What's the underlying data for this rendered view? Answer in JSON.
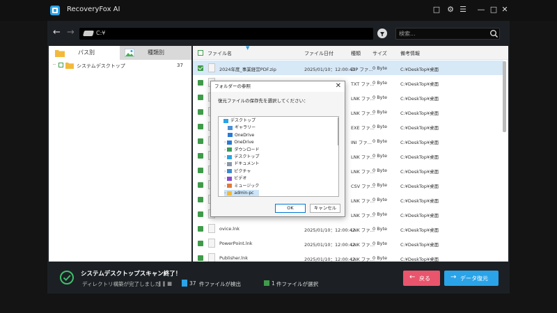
{
  "app": {
    "title": "RecoveryFox AI"
  },
  "toolbar": {
    "path": "C:¥",
    "search_placeholder": "検索..."
  },
  "left_panel": {
    "tab_folder": "パス別",
    "tab_type": "種類別",
    "tree": [
      {
        "label": "システムデスクトップ",
        "count": "37"
      }
    ]
  },
  "table": {
    "headers": {
      "name": "ファイル名",
      "date": "ファイル日付",
      "type": "種類",
      "size": "サイズ",
      "note": "備考情報"
    },
    "rows": [
      {
        "name": "2024年度_事業経営PDF.zip",
        "date": "2025/01/10：12:00:42",
        "type": "ZIP ファ...",
        "size": "0 Byte",
        "note": "C:¥DeskTop¥桌面",
        "selected": true
      },
      {
        "name": "",
        "date": "",
        "type": "TXT ファ...",
        "size": "0 Byte",
        "note": "C:¥DeskTop¥桌面"
      },
      {
        "name": "",
        "date": "",
        "type": "LNK ファ...",
        "size": "0 Byte",
        "note": "C:¥DeskTop¥桌面"
      },
      {
        "name": "",
        "date": "",
        "type": "LNK ファ...",
        "size": "0 Byte",
        "note": "C:¥DeskTop¥桌面"
      },
      {
        "name": "",
        "date": "",
        "type": "EXE ファ...",
        "size": "0 Byte",
        "note": "C:¥DeskTop¥桌面"
      },
      {
        "name": "",
        "date": "",
        "type": "INI ファ...",
        "size": "0 Byte",
        "note": "C:¥DeskTop¥桌面"
      },
      {
        "name": "",
        "date": "",
        "type": "LNK ファ...",
        "size": "0 Byte",
        "note": "C:¥DeskTop¥桌面"
      },
      {
        "name": "",
        "date": "",
        "type": "LNK ファ...",
        "size": "0 Byte",
        "note": "C:¥DeskTop¥桌面"
      },
      {
        "name": "",
        "date": "",
        "type": "CSV ファ...",
        "size": "0 Byte",
        "note": "C:¥DeskTop¥桌面"
      },
      {
        "name": "",
        "date": "",
        "type": "LNK ファ...",
        "size": "0 Byte",
        "note": "C:¥DeskTop¥桌面"
      },
      {
        "name": "",
        "date": "",
        "type": "LNK ファ...",
        "size": "0 Byte",
        "note": "C:¥DeskTop¥桌面"
      },
      {
        "name": "ovice.lnk",
        "date": "2025/01/10：12:00:42",
        "type": "LNK ファ...",
        "size": "0 Byte",
        "note": "C:¥DeskTop¥桌面"
      },
      {
        "name": "PowerPoint.lnk",
        "date": "2025/01/10：12:00:42",
        "type": "LNK ファ...",
        "size": "0 Byte",
        "note": "C:¥DeskTop¥桌面"
      },
      {
        "name": "Publisher.lnk",
        "date": "2025/01/10：12:00:42",
        "type": "LNK ファ...",
        "size": "0 Byte",
        "note": "C:¥DeskTop¥桌面"
      }
    ]
  },
  "dialog": {
    "title": "フォルダーの参照",
    "message": "復元ファイルの保存先を選択してください：",
    "tree": [
      "デスクトップ",
      "ギャラリー",
      "OneDrive",
      "OneDrive",
      "ダウンロード",
      "デスクトップ",
      "ドキュメント",
      "ピクチャ",
      "ビデオ",
      "ミュージック",
      "admin-pc"
    ],
    "ok": "OK",
    "cancel": "キャンセル"
  },
  "status": {
    "title": "システムデスクトップスキャン終了！",
    "sub": "ディレクトリ構築が完了しました",
    "found_count": "37",
    "found_text": " 件ファイルが検出",
    "selected_count": "1",
    "selected_text": " 件ファイルが選択",
    "back_label": "戻る",
    "recover_label": "データ復元"
  },
  "colors": {
    "accent": "#2aa3e8",
    "back": "#e9556c",
    "check": "#3f9b4a"
  }
}
